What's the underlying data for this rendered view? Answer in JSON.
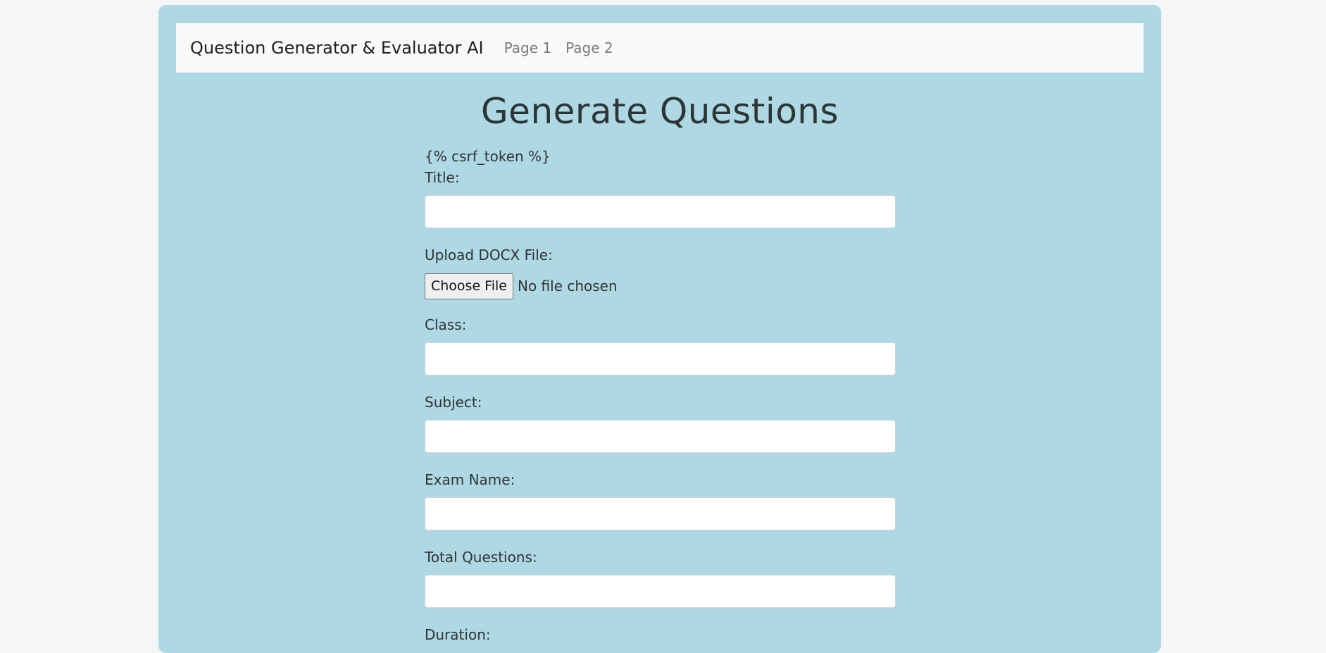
{
  "navbar": {
    "brand": "Question Generator & Evaluator AI",
    "links": [
      "Page 1",
      "Page 2"
    ]
  },
  "page": {
    "title": "Generate Questions",
    "template_token": "{% csrf_token %}"
  },
  "form": {
    "title_label": "Title:",
    "upload_label": "Upload DOCX File:",
    "choose_file_label": "Choose File",
    "file_status": "No file chosen",
    "class_label": "Class:",
    "subject_label": "Subject:",
    "exam_name_label": "Exam Name:",
    "total_questions_label": "Total Questions:",
    "duration_label": "Duration:",
    "title_value": "",
    "class_value": "",
    "subject_value": "",
    "exam_name_value": "",
    "total_questions_value": ""
  },
  "colors": {
    "page_background": "#f4f6f8",
    "card_background": "#add8e4",
    "navbar_background": "#f8f9fa"
  }
}
